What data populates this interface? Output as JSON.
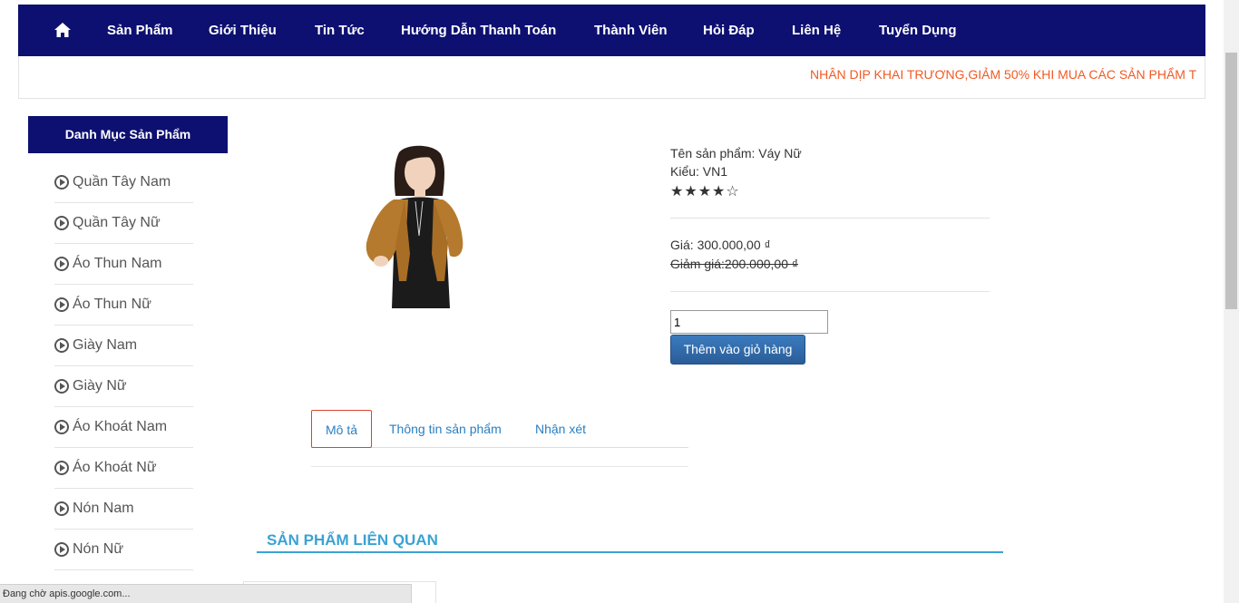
{
  "nav": {
    "items": [
      "Sản Phẩm",
      "Giới Thiệu",
      "Tin Tức",
      "Hướng Dẫn Thanh Toán",
      "Thành Viên",
      "Hỏi Đáp",
      "Liên Hệ",
      "Tuyển Dụng"
    ]
  },
  "marquee": {
    "text": "NHÂN DỊP KHAI TRƯƠNG,GIẢM 50% KHI MUA CÁC SẢN PHẨM T"
  },
  "sidebar": {
    "title": "Danh Mục Sản Phẩm",
    "items": [
      "Quần Tây Nam",
      "Quần Tây Nữ",
      "Áo Thun Nam",
      "Áo Thun Nữ",
      "Giày Nam",
      "Giày Nữ",
      "Áo Khoát Nam",
      "Áo Khoát Nữ",
      "Nón Nam",
      "Nón Nữ"
    ]
  },
  "product": {
    "name_line": "Tên sản phẩm: Váy Nữ",
    "type_line": "Kiểu: VN1",
    "rating": 4,
    "rating_max": 5,
    "price_line": "Giá: 300.000,00 ₫",
    "discount_line": "Giảm giá:200.000,00 ₫",
    "quantity": "1",
    "add_to_cart": "Thêm vào giỏ hàng",
    "image_colors": {
      "cardigan": "#b57a2e",
      "top": "#1b1b1b",
      "skin": "#f1d3bd",
      "hair": "#2a1c16"
    }
  },
  "tabs": {
    "items": [
      "Mô tả",
      "Thông tin sản phẩm",
      "Nhận xét"
    ],
    "active": 0
  },
  "related": {
    "title": "SẢN PHẨM LIÊN QUAN"
  },
  "status_bar": {
    "text": "Đang chờ apis.google.com..."
  },
  "colors": {
    "nav_bg": "#0d1070",
    "marquee": "#f15a24",
    "link": "#2a7fc1",
    "related": "#3aa2d4"
  }
}
